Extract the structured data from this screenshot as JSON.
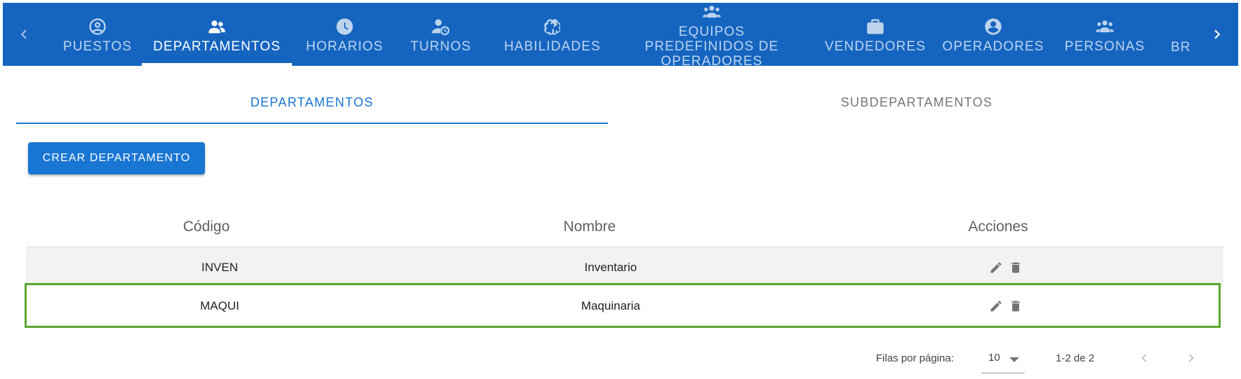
{
  "nav": {
    "tabs": [
      {
        "label": "PUESTOS",
        "icon": "account-circle-outline-icon"
      },
      {
        "label": "DEPARTAMENTOS",
        "icon": "people-icon"
      },
      {
        "label": "HORARIOS",
        "icon": "clock-icon"
      },
      {
        "label": "TURNOS",
        "icon": "person-clock-icon"
      },
      {
        "label": "HABILIDADES",
        "icon": "brain-icon"
      },
      {
        "label": "EQUIPOS PREDEFINIDOS DE OPERADORES",
        "icon": "groups-icon"
      },
      {
        "label": "VENDEDORES",
        "icon": "briefcase-icon"
      },
      {
        "label": "OPERADORES",
        "icon": "account-circle-icon"
      },
      {
        "label": "PERSONAS",
        "icon": "groups-icon"
      },
      {
        "label": "BR",
        "icon": ""
      }
    ],
    "active_tab": "DEPARTAMENTOS"
  },
  "subtabs": {
    "departamentos": "DEPARTAMENTOS",
    "subdepartamentos": "SUBDEPARTAMENTOS",
    "active": "DEPARTAMENTOS"
  },
  "actions": {
    "create_label": "CREAR DEPARTAMENTO"
  },
  "table": {
    "headers": {
      "codigo": "Código",
      "nombre": "Nombre",
      "acciones": "Acciones"
    },
    "rows": [
      {
        "codigo": "INVEN",
        "nombre": "Inventario"
      },
      {
        "codigo": "MAQUI",
        "nombre": "Maquinaria"
      }
    ]
  },
  "pagination": {
    "rows_per_page_label": "Filas por página:",
    "rows_per_page": "10",
    "range": "1-2 de 2"
  },
  "colors": {
    "nav_bar": "#1565c0",
    "accent": "#1976d2",
    "highlight_border": "#5ba62f"
  }
}
